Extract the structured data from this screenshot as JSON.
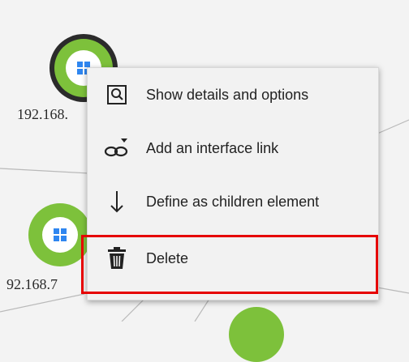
{
  "nodes": [
    {
      "label": "192.168.",
      "icon": "windows-icon"
    },
    {
      "label": "92.168.7",
      "icon": "windows-icon"
    }
  ],
  "context_menu": {
    "items": [
      {
        "label": "Show details and options",
        "icon": "magnifier-icon"
      },
      {
        "label": "Add an interface link",
        "icon": "link-icon"
      },
      {
        "label": "Define as children element",
        "icon": "arrow-down-icon"
      },
      {
        "label": "Delete",
        "icon": "trash-icon"
      }
    ]
  },
  "colors": {
    "node_green": "#7dc13b",
    "selected_ring": "#2b2b2b",
    "highlight_red": "#e60000",
    "windows_blue": "#2f86f0"
  }
}
